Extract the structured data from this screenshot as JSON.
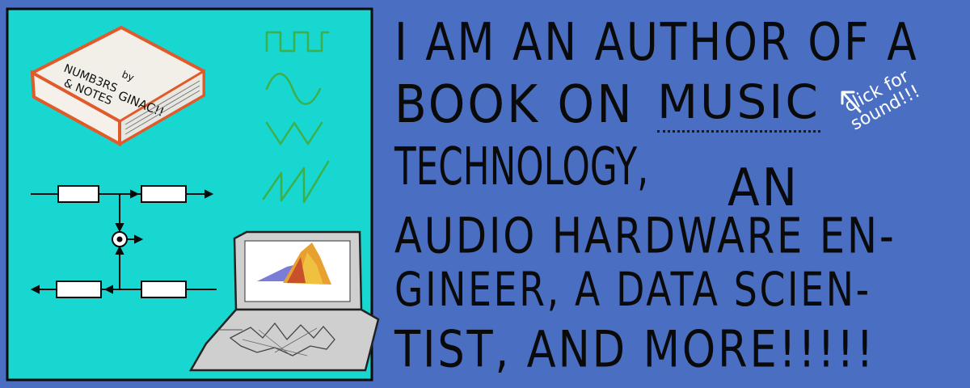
{
  "book": {
    "title_line1": "NUMB3RS",
    "title_line2": "& NOTES",
    "by": "by",
    "author": "GINAC!!"
  },
  "heading": {
    "line1": "I AM AN AUTHOR OF A",
    "line2_prefix": "BOOK ON",
    "link_word": "MUSIC",
    "line3a": "TECHNOLOGY,",
    "line3b": "AN",
    "line4": "AUDIO HARDWARE EN-",
    "line5": "GINEER, A DATA SCIEN-",
    "line6": "TIST, AND MORE!!!!!"
  },
  "hint": {
    "line1": "click for",
    "line2": "sound!!!"
  },
  "colors": {
    "background": "#4a6fc2",
    "panel": "#18d6d0",
    "ink": "#0a0a0a",
    "wave": "#3cb04a",
    "hint": "#ffffff"
  }
}
